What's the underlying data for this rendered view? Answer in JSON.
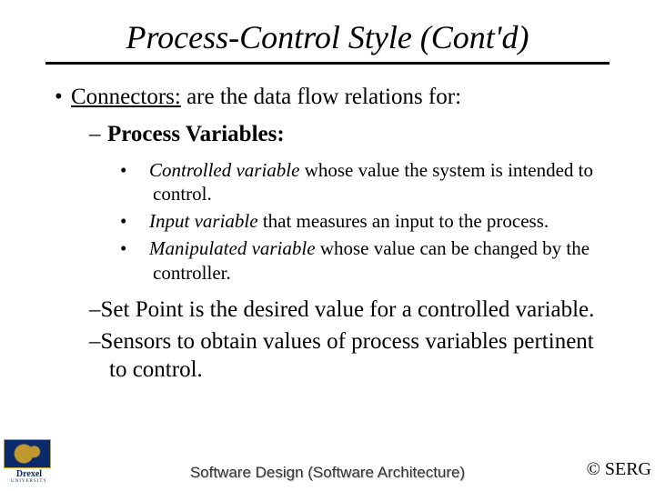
{
  "title": "Process-Control Style (Cont'd)",
  "l1": {
    "label": "Connectors:",
    "rest": " are the data flow relations for:"
  },
  "l2a": {
    "label": "Process Variables:"
  },
  "l3": [
    {
      "ital": "Controlled variable",
      "rest": " whose value the system is intended to control."
    },
    {
      "ital": "Input variable",
      "rest": " that measures an input to the process."
    },
    {
      "ital": "Manipulated variable",
      "rest": " whose value can be changed by the controller."
    }
  ],
  "l2b": {
    "bold": "Set Point",
    "rest": " is the desired value for a controlled variable."
  },
  "l2c": {
    "bold": "Sensors",
    "rest": " to obtain values of process variables pertinent to control."
  },
  "footer": {
    "center": "Software Design (Software Architecture)",
    "right": "© SERG",
    "logo_name": "Drexel",
    "logo_sub": "UNIVERSITY"
  }
}
